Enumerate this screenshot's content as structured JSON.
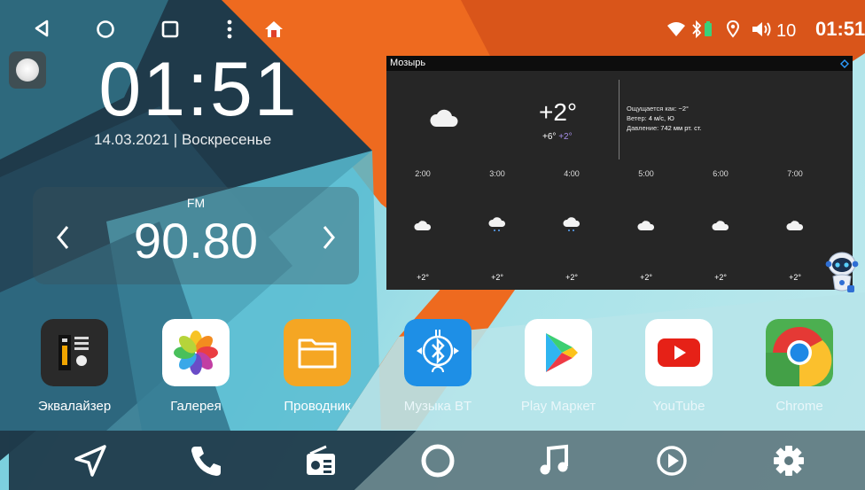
{
  "status_bar": {
    "nav_icons": [
      "back-icon",
      "home-circle-icon",
      "recents-icon",
      "more-vert-icon",
      "house-icon"
    ],
    "status_icons": [
      "wifi-icon",
      "bluetooth-icon",
      "battery-icon",
      "location-icon",
      "volume-icon"
    ],
    "volume": "10",
    "time": "01:51"
  },
  "clock": {
    "time": "01:51",
    "date": "14.03.2021  |  Воскресенье"
  },
  "radio": {
    "band": "FM",
    "frequency": "90.80",
    "prev_label": "‹",
    "next_label": "›"
  },
  "weather": {
    "city": "Мозырь",
    "current_temp": "+2°",
    "high": "+6°",
    "low": "+2°",
    "feels_like_label": "Ощущается как:",
    "feels_like": "−2°",
    "wind_label": "Ветер:",
    "wind": "4 м/с, Ю",
    "pressure_label": "Давление:",
    "pressure": "742 мм рт. ст.",
    "hours": [
      {
        "time": "2:00",
        "temp": "+2°",
        "icon": "cloudy-night-icon"
      },
      {
        "time": "3:00",
        "temp": "+2°",
        "icon": "rain-cloud-icon"
      },
      {
        "time": "4:00",
        "temp": "+2°",
        "icon": "rain-cloud-icon"
      },
      {
        "time": "5:00",
        "temp": "+2°",
        "icon": "cloudy-night-icon"
      },
      {
        "time": "6:00",
        "temp": "+2°",
        "icon": "cloudy-night-icon"
      },
      {
        "time": "7:00",
        "temp": "+2°",
        "icon": "cloudy-night-icon"
      }
    ]
  },
  "apps": [
    {
      "label": "Эквалайзер",
      "icon": "equalizer-icon"
    },
    {
      "label": "Галерея",
      "icon": "gallery-icon"
    },
    {
      "label": "Проводник",
      "icon": "folder-icon"
    },
    {
      "label": "Музыка BT",
      "icon": "bluetooth-music-icon"
    },
    {
      "label": "Play Маркет",
      "icon": "play-store-icon"
    },
    {
      "label": "YouTube",
      "icon": "youtube-icon"
    },
    {
      "label": "Chrome",
      "icon": "chrome-icon"
    }
  ],
  "dock": [
    "navigation-icon",
    "phone-icon",
    "radio-icon",
    "home-circle-icon",
    "music-note-icon",
    "video-play-icon",
    "settings-gear-icon"
  ],
  "colors": {
    "background_teal": "#5fc6d8",
    "accent_orange": "#ee6a1f",
    "dark_navy": "#1f3a4a",
    "weather_bg": "#262626",
    "hilo_low": "#a58ee8"
  }
}
